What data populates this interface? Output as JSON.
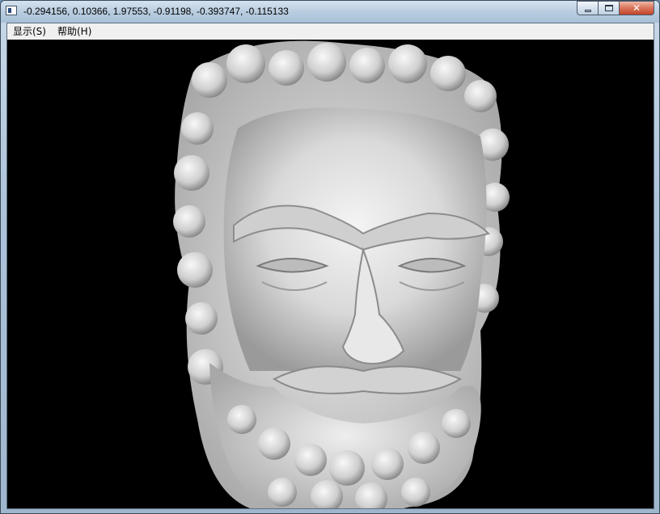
{
  "window": {
    "title": "-0.294156, 0.10366, 1.97553, -0.91198, -0.393747, -0.115133",
    "close_glyph": "✕"
  },
  "menu": {
    "items": [
      {
        "label": "显示(S)"
      },
      {
        "label": "帮助(H)"
      }
    ]
  },
  "viewport": {
    "background": "#000000",
    "model_color": "#e6e6e6",
    "model_shadow": "#8a8a8a"
  }
}
